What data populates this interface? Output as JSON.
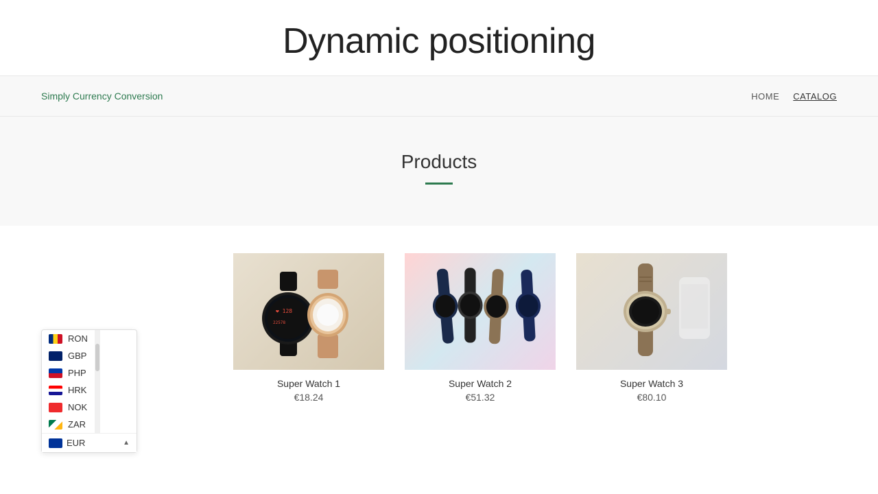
{
  "page": {
    "title": "Dynamic positioning"
  },
  "navbar": {
    "brand": "Simply Currency Conversion",
    "links": [
      {
        "label": "HOME",
        "active": false
      },
      {
        "label": "CATALOG",
        "active": true
      }
    ]
  },
  "products_section": {
    "title": "Products",
    "underline": true
  },
  "products": [
    {
      "name": "Super Watch 1",
      "price": "€18.24",
      "image_type": "watch1"
    },
    {
      "name": "Super Watch 2",
      "price": "€51.32",
      "image_type": "watch2"
    },
    {
      "name": "Super Watch 3",
      "price": "€80.10",
      "image_type": "watch3"
    }
  ],
  "currency_selector": {
    "currencies": [
      {
        "code": "RON",
        "flag_class": "flag-ron"
      },
      {
        "code": "GBP",
        "flag_class": "flag-gbp"
      },
      {
        "code": "PHP",
        "flag_class": "flag-php"
      },
      {
        "code": "HRK",
        "flag_class": "flag-hrk"
      },
      {
        "code": "NOK",
        "flag_class": "flag-nok"
      },
      {
        "code": "ZAR",
        "flag_class": "flag-zar"
      }
    ],
    "selected": {
      "code": "EUR",
      "flag_class": "flag-eur"
    },
    "chevron": "▲"
  }
}
